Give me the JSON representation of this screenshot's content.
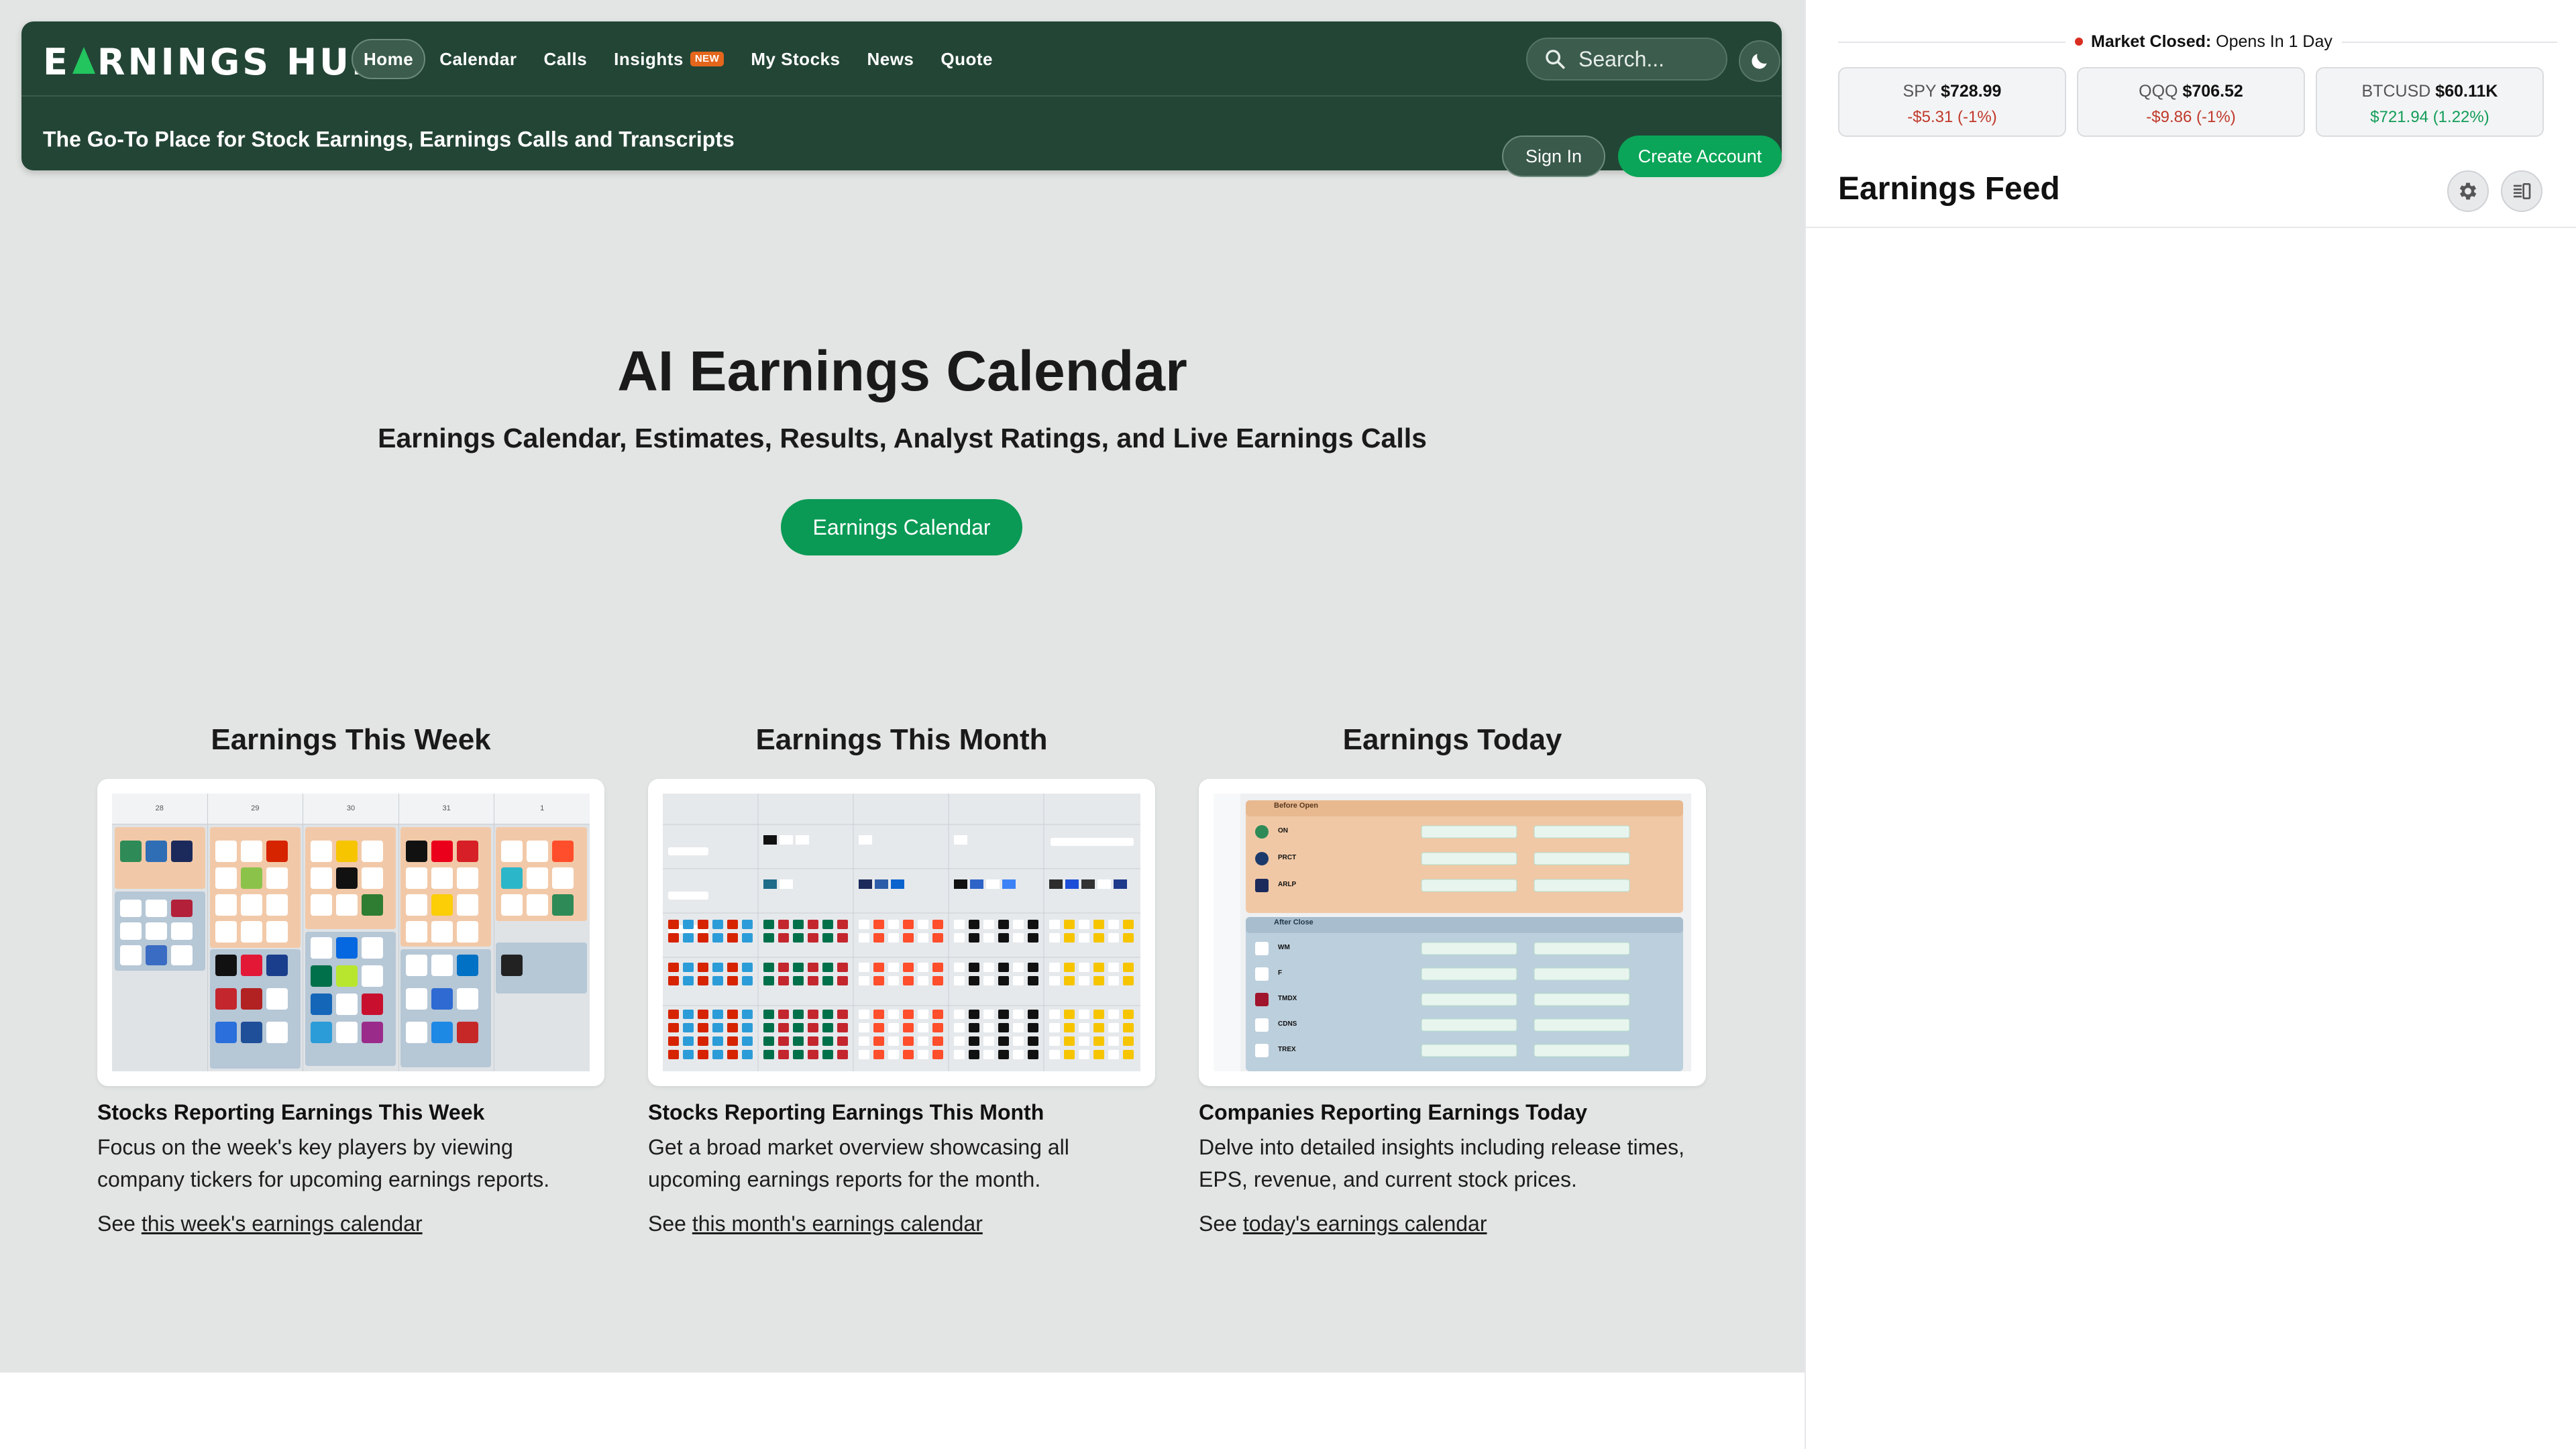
{
  "brand": {
    "logo_text_1": "E",
    "logo_text_2": "RNINGS HUB",
    "logo_full": "EARNINGS HUB",
    "tagline": "The Go-To Place for Stock Earnings, Earnings Calls and Transcripts"
  },
  "nav": {
    "items": [
      {
        "label": "Home",
        "active": true
      },
      {
        "label": "Calendar"
      },
      {
        "label": "Calls"
      },
      {
        "label": "Insights",
        "badge": "NEW"
      },
      {
        "label": "My Stocks"
      },
      {
        "label": "News"
      },
      {
        "label": "Quote"
      }
    ],
    "search_placeholder": "Search...",
    "theme_icon": "moon-icon",
    "sign_in": "Sign In",
    "create_account": "Create Account"
  },
  "hero": {
    "title": "AI Earnings Calendar",
    "subtitle": "Earnings Calendar, Estimates, Results, Analyst Ratings, and Live Earnings Calls",
    "button": "Earnings Calendar"
  },
  "cards": [
    {
      "heading": "Earnings This Week",
      "title": "Stocks Reporting Earnings This Week",
      "desc": "Focus on the week's key players by viewing company tickers for upcoming earnings reports.",
      "see": "See ",
      "link": "this week's earnings calendar",
      "days": [
        "28",
        "29",
        "30",
        "31",
        "1"
      ]
    },
    {
      "heading": "Earnings This Month",
      "title": "Stocks Reporting Earnings This Month",
      "desc": "Get a broad market overview showcasing all upcoming earnings reports for the month.",
      "see": "See ",
      "link": "this month's earnings calendar"
    },
    {
      "heading": "Earnings Today",
      "title": "Companies Reporting Earnings Today",
      "desc": "Delve into detailed insights including release times, EPS, revenue, and current stock prices.",
      "see": "See ",
      "link": "today's earnings calendar",
      "sections": [
        "Before Open",
        "After Close"
      ],
      "rows_before": [
        "ON",
        "PRCT",
        "ARLP"
      ],
      "rows_after": [
        "WM",
        "F",
        "TMDX",
        "CDNS",
        "TREX"
      ]
    }
  ],
  "sidebar": {
    "market_label": "Market Closed:",
    "market_text": "Opens In 1 Day",
    "tickers": [
      {
        "symbol": "SPY",
        "price": "$728.99",
        "change": "-$5.31 (-1%)",
        "direction": "down"
      },
      {
        "symbol": "QQQ",
        "price": "$706.52",
        "change": "-$9.86 (-1%)",
        "direction": "down"
      },
      {
        "symbol": "BTCUSD",
        "price": "$60.11K",
        "change": "$721.94 (1.22%)",
        "direction": "up"
      }
    ],
    "feed_title": "Earnings Feed",
    "settings_icon": "gear-icon",
    "layout_icon": "panel-toggle-icon"
  },
  "colors": {
    "nav_bg": "#234536",
    "accent_green": "#0a9a55",
    "badge_orange": "#e4661c",
    "negative": "#c0392b",
    "positive": "#129d59"
  }
}
